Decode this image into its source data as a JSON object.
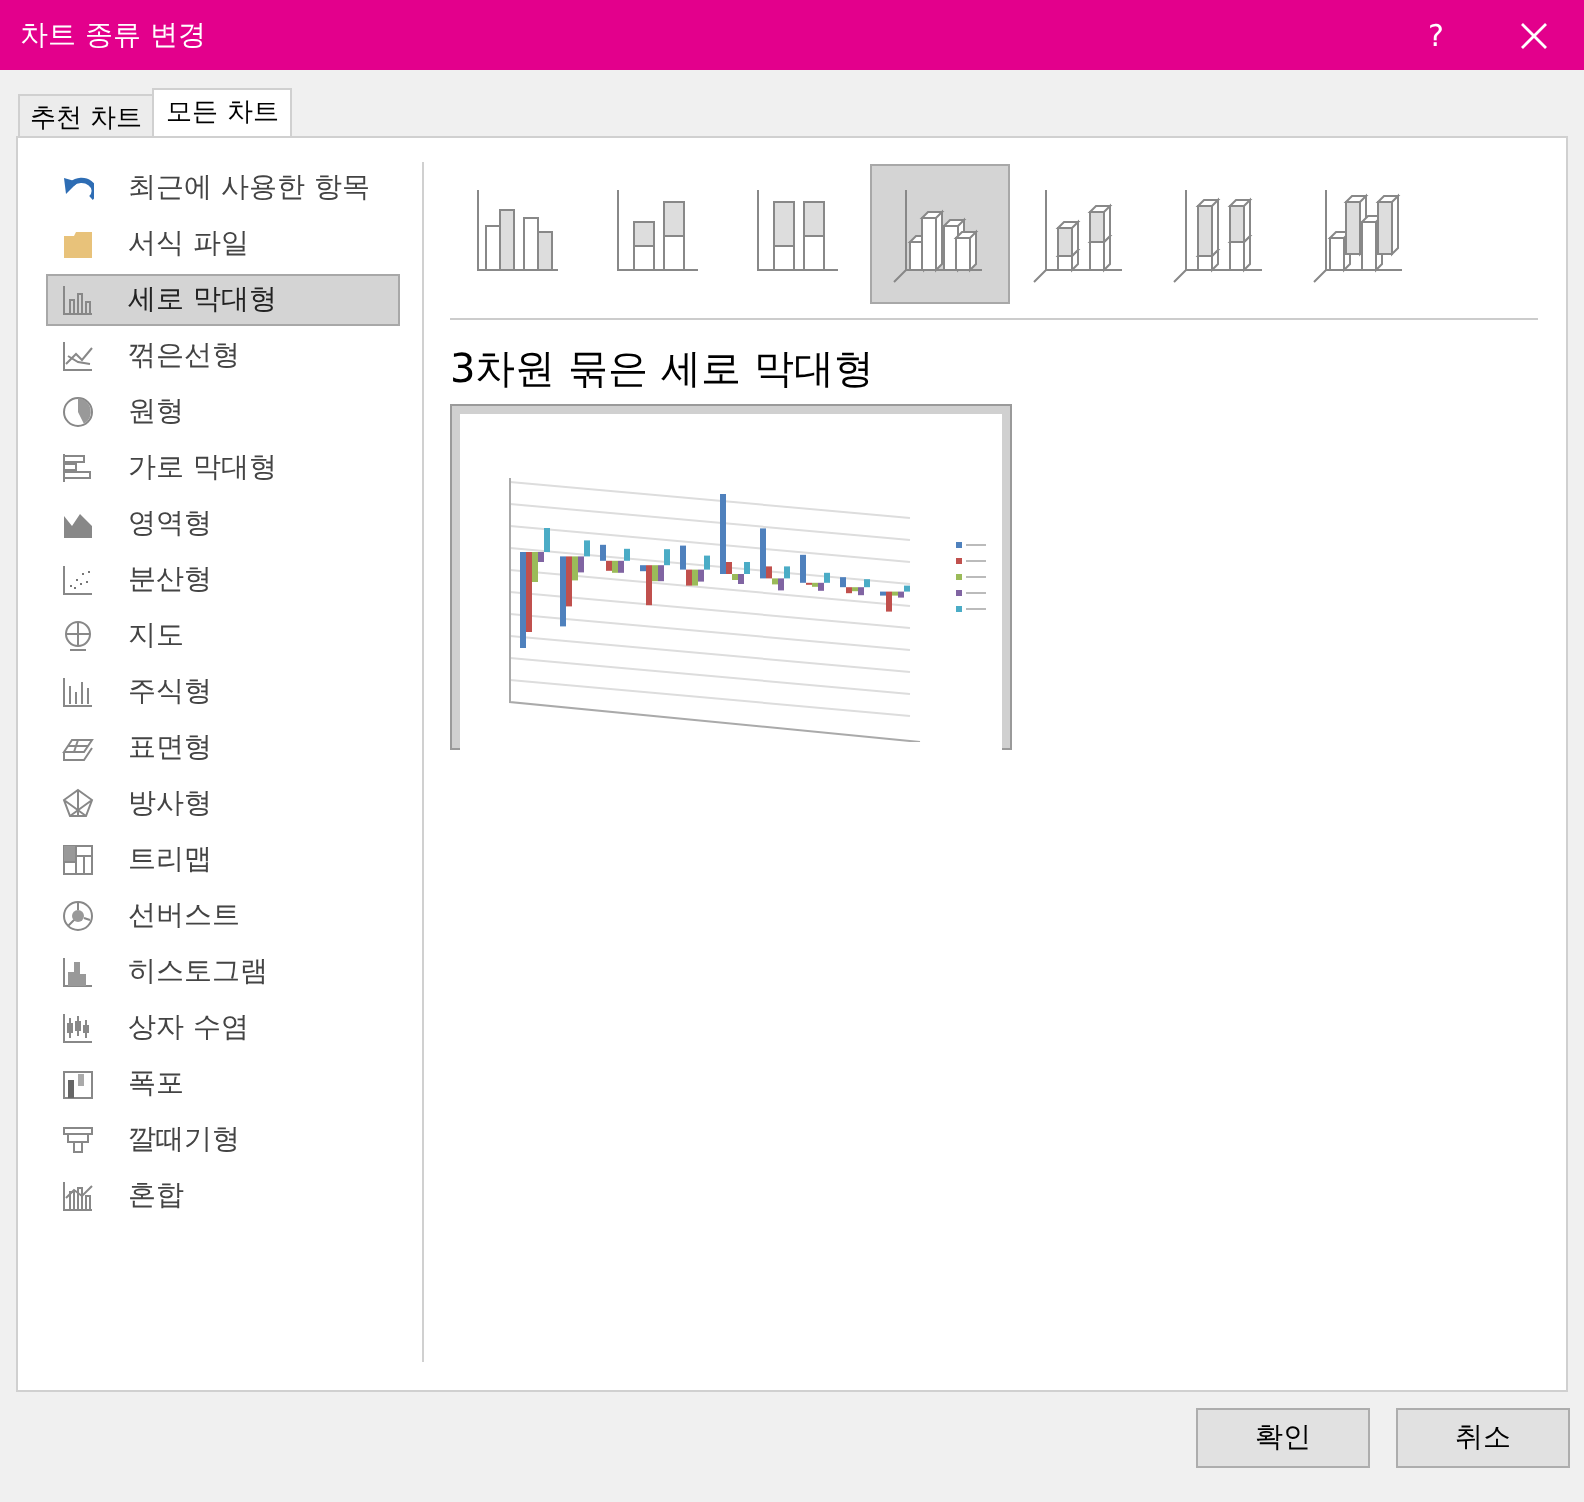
{
  "window": {
    "title": "차트 종류 변경",
    "help": "?"
  },
  "tabs": [
    {
      "label": "추천 차트",
      "selected": false
    },
    {
      "label": "모든 차트",
      "selected": true
    }
  ],
  "sidebar": {
    "items": [
      {
        "label": "최근에 사용한 항목",
        "selected": false
      },
      {
        "label": "서식 파일",
        "selected": false
      },
      {
        "label": "세로 막대형",
        "selected": true
      },
      {
        "label": "꺾은선형",
        "selected": false
      },
      {
        "label": "원형",
        "selected": false
      },
      {
        "label": "가로 막대형",
        "selected": false
      },
      {
        "label": "영역형",
        "selected": false
      },
      {
        "label": "분산형",
        "selected": false
      },
      {
        "label": "지도",
        "selected": false
      },
      {
        "label": "주식형",
        "selected": false
      },
      {
        "label": "표면형",
        "selected": false
      },
      {
        "label": "방사형",
        "selected": false
      },
      {
        "label": "트리맵",
        "selected": false
      },
      {
        "label": "선버스트",
        "selected": false
      },
      {
        "label": "히스토그램",
        "selected": false
      },
      {
        "label": "상자 수염",
        "selected": false
      },
      {
        "label": "폭포",
        "selected": false
      },
      {
        "label": "깔때기형",
        "selected": false
      },
      {
        "label": "혼합",
        "selected": false
      }
    ]
  },
  "subtypes": [
    {
      "selected": false
    },
    {
      "selected": false
    },
    {
      "selected": false
    },
    {
      "selected": true
    },
    {
      "selected": false
    },
    {
      "selected": false
    },
    {
      "selected": false
    }
  ],
  "preview": {
    "title": "3차원 묶은 세로 막대형"
  },
  "buttons": [
    {
      "label": "확인"
    },
    {
      "label": "취소"
    }
  ]
}
